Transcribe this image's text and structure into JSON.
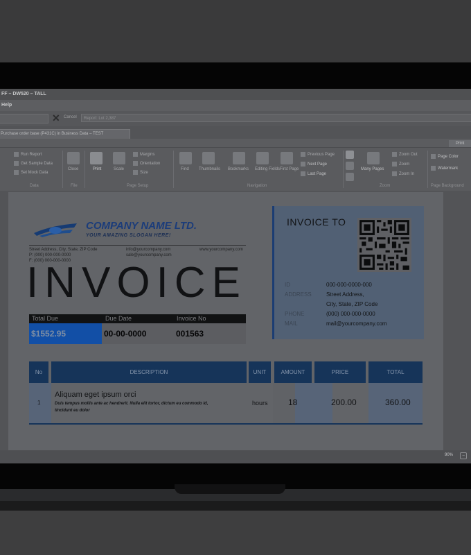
{
  "window": {
    "title_fragment": "FF – DW520 – TALL",
    "menu_fragment": "Help"
  },
  "search": {
    "cancel_label": "Cancel",
    "placeholder": "Report: Lot 2,387"
  },
  "tab": {
    "label": "Purchase order base (P431C) in Business Data – TEST"
  },
  "print_tab": "Print",
  "ribbon": {
    "data_group": {
      "label": "Data",
      "items": [
        "Run Report",
        "Get Sample Data",
        "Set Mock Data"
      ]
    },
    "file_group": {
      "label": "File",
      "items": [
        "Close"
      ]
    },
    "print_item": "Print",
    "scale_item": "Scale",
    "page_setup_group": {
      "label": "Page Setup",
      "items": [
        "Margins",
        "Orientation",
        "Size"
      ]
    },
    "navigation_group": {
      "label": "Navigation",
      "items": [
        "Find",
        "Thumbnails",
        "Bookmarks",
        "Editing Fields",
        "First Page",
        "Previous Page",
        "Next Page",
        "Last Page"
      ]
    },
    "zoom_group": {
      "label": "Zoom",
      "many_pages": "Many Pages",
      "items": [
        "Zoom Out",
        "Zoom",
        "Zoom In"
      ]
    },
    "background_group": {
      "label": "Page Background",
      "items": [
        "Page Color",
        "Watermark"
      ]
    }
  },
  "invoice": {
    "company_name": "COMPANY NAME LTD.",
    "slogan": "YOUR AMAZING SLOGAN HERE!",
    "address_lines": [
      "Street Address, City, State, ZIP Code",
      "P: (000) 000-000-0000",
      "F: (000) 000-000-0000"
    ],
    "email_lines": [
      "info@yourcompany.com",
      "sale@yourcompany.com"
    ],
    "website": "www.yourcompany.com",
    "heading": "INVOICE",
    "summary": {
      "total_due_label": "Total Due",
      "due_date_label": "Due Date",
      "invoice_no_label": "Invoice No",
      "total_due": "$1552.95",
      "due_date": "00-00-0000",
      "invoice_no": "001563"
    },
    "invoice_to": {
      "title": "INVOICE TO",
      "fields": [
        {
          "label": "ID",
          "value": "000-000-0000-000"
        },
        {
          "label": "ADDRESS",
          "value": "Street Address,"
        },
        {
          "label": "",
          "value": "City, State, ZIP Code"
        },
        {
          "label": "PHONE",
          "value": "(000) 000-000-0000"
        },
        {
          "label": "MAIL",
          "value": "mail@yourcompany.com"
        }
      ]
    },
    "table": {
      "columns": [
        "No",
        "DESCRIPTION",
        "UNIT",
        "AMOUNT",
        "PRICE",
        "TOTAL"
      ],
      "rows": [
        {
          "no": "1",
          "title": "Aliquam eget ipsum orci",
          "desc_lines": [
            "Duis tempus mollis ante ac hendrerit. Nulla elit tortor, dictum eu commodo id,",
            "tincidunt eu dolor"
          ],
          "unit": "hours",
          "amount": "18",
          "price": "200.00",
          "total": "360.00"
        }
      ]
    }
  },
  "status": {
    "zoom": "90%"
  },
  "colors": {
    "accent_blue": "#1b3d73",
    "highlight_blue": "#124fa6"
  }
}
